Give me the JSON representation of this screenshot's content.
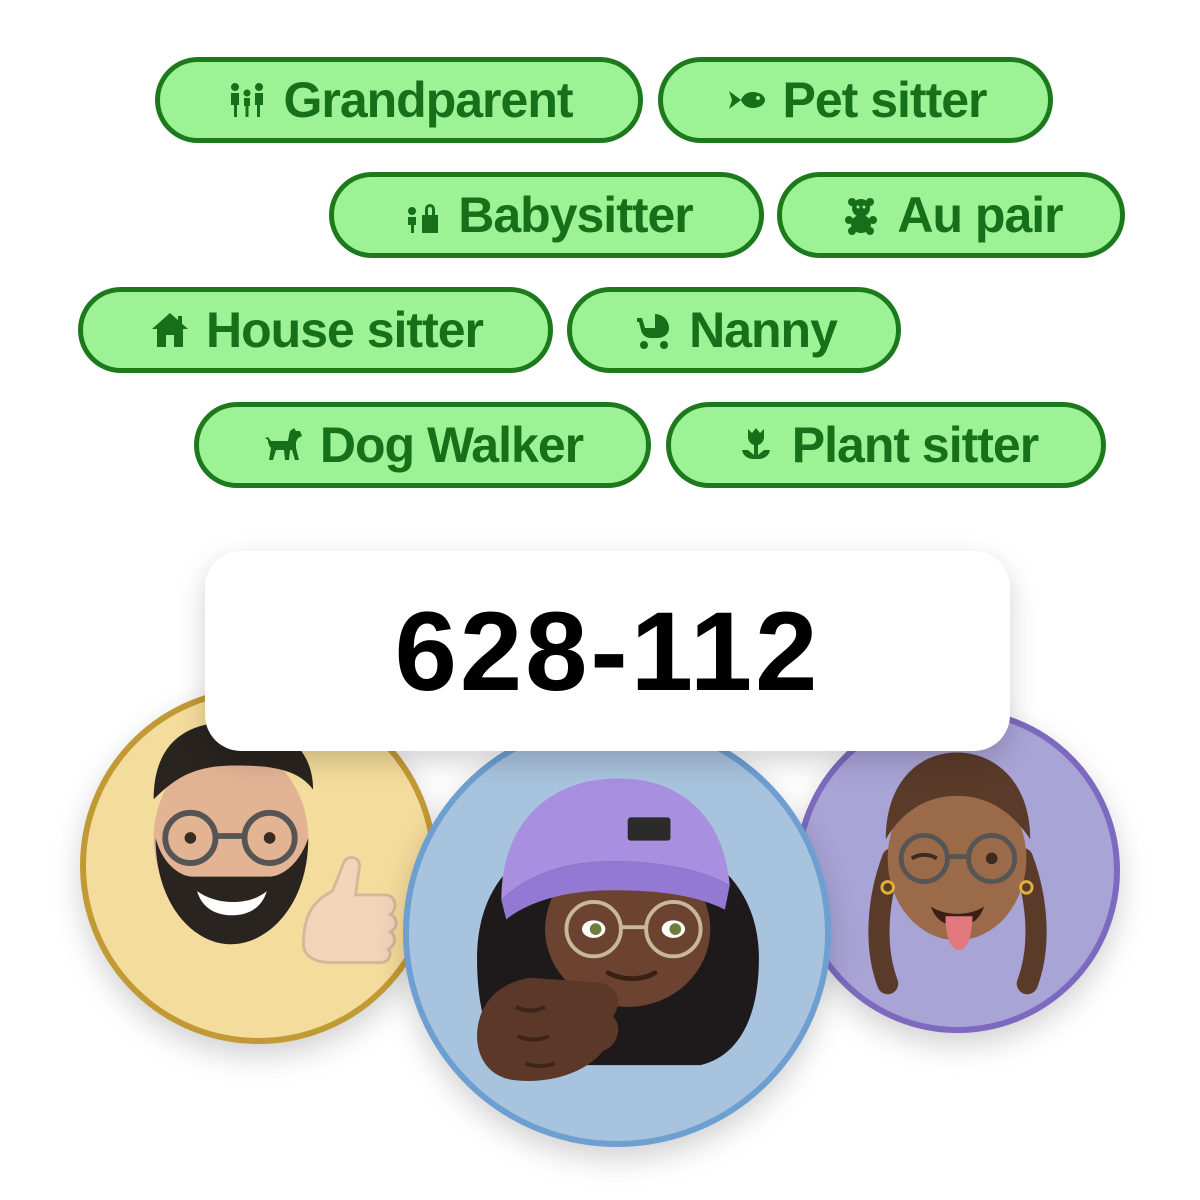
{
  "chips": [
    {
      "label": "Grandparent",
      "icon": "family-icon"
    },
    {
      "label": "Pet sitter",
      "icon": "fish-icon"
    },
    {
      "label": "Babysitter",
      "icon": "child-lock-icon"
    },
    {
      "label": "Au pair",
      "icon": "teddy-bear-icon"
    },
    {
      "label": "House sitter",
      "icon": "house-icon"
    },
    {
      "label": "Nanny",
      "icon": "stroller-icon"
    },
    {
      "label": "Dog Walker",
      "icon": "dog-icon"
    },
    {
      "label": "Plant sitter",
      "icon": "tulip-icon"
    }
  ],
  "code": "628-112",
  "avatars": [
    {
      "icon": "memoji-bearded-man-icon",
      "bg": "#f4dc9c",
      "border": "#c29a35"
    },
    {
      "icon": "memoji-woman-beanie-icon",
      "bg": "#a8c3de",
      "border": "#6d9fd1"
    },
    {
      "icon": "memoji-girl-braids-icon",
      "bg": "#a9a4d6",
      "border": "#7d69bf"
    }
  ],
  "colors": {
    "chip_bg": "#9cf294",
    "chip_border": "#1c7a1c",
    "chip_text": "#16701a"
  }
}
